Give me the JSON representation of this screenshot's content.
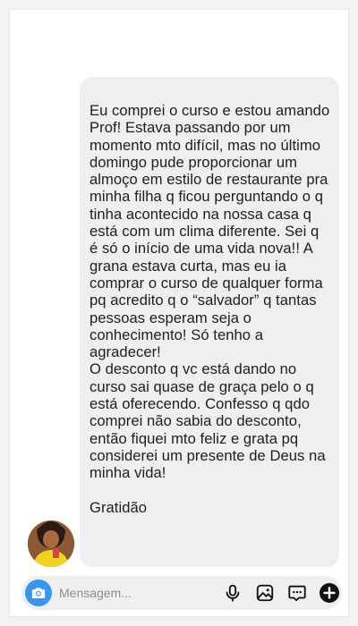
{
  "message": {
    "body": "Eu comprei o curso e estou amando Prof! Estava passando por um momento mto difícil, mas no último domingo pude proporcionar um almoço em estilo de restaurante pra minha filha q ficou perguntando o q tinha acontecido na nossa casa q está com um clima diferente. Sei q é só o início de uma vida nova!! A grana estava curta, mas eu ia comprar o curso de qualquer forma pq acredito q o “salvador” q tantas pessoas esperam seja o conhecimento! Só tenho a agradecer!\nO desconto q vc está dando no curso sai quase de graça pelo o q está oferecendo. Confesso q qdo comprei não sabia do desconto, então fiquei mto feliz e grata pq considerei um presente de Deus na minha vida!",
    "signoff": "Gratidão"
  },
  "composer": {
    "placeholder": "Mensagem...",
    "icons": {
      "camera": "camera-icon",
      "mic": "microphone-icon",
      "gallery": "gallery-icon",
      "sticker": "sticker-icon",
      "plus": "plus-icon"
    }
  },
  "colors": {
    "bubble_bg": "#efefef",
    "composer_bg": "#efefef",
    "camera_accent": "#3797f0",
    "text": "#1e1e1e"
  }
}
